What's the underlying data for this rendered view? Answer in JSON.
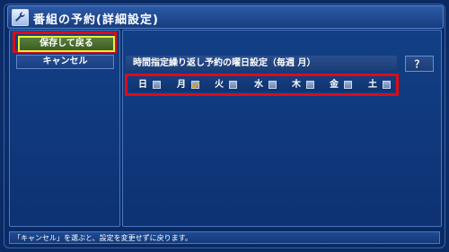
{
  "window": {
    "title": "番組の予約(詳細設定)",
    "icon": "wrench-icon"
  },
  "left_menu": {
    "save_label": "保存して戻る",
    "cancel_label": "キャンセル"
  },
  "setting": {
    "label": "時間指定繰り返し予約の曜日設定（毎週 月）",
    "help_label": "？"
  },
  "days": [
    {
      "label": "日",
      "checked": false
    },
    {
      "label": "月",
      "checked": true
    },
    {
      "label": "火",
      "checked": false
    },
    {
      "label": "水",
      "checked": false
    },
    {
      "label": "木",
      "checked": false
    },
    {
      "label": "金",
      "checked": false
    },
    {
      "label": "土",
      "checked": false
    }
  ],
  "status": {
    "text": "「キャンセル」を選ぶと、設定を変更せずに戻ります。"
  },
  "colors": {
    "highlight": "#e10a14",
    "focus": "#e8ef3a",
    "background": "#0b2e6b",
    "check": "#e0a020"
  }
}
